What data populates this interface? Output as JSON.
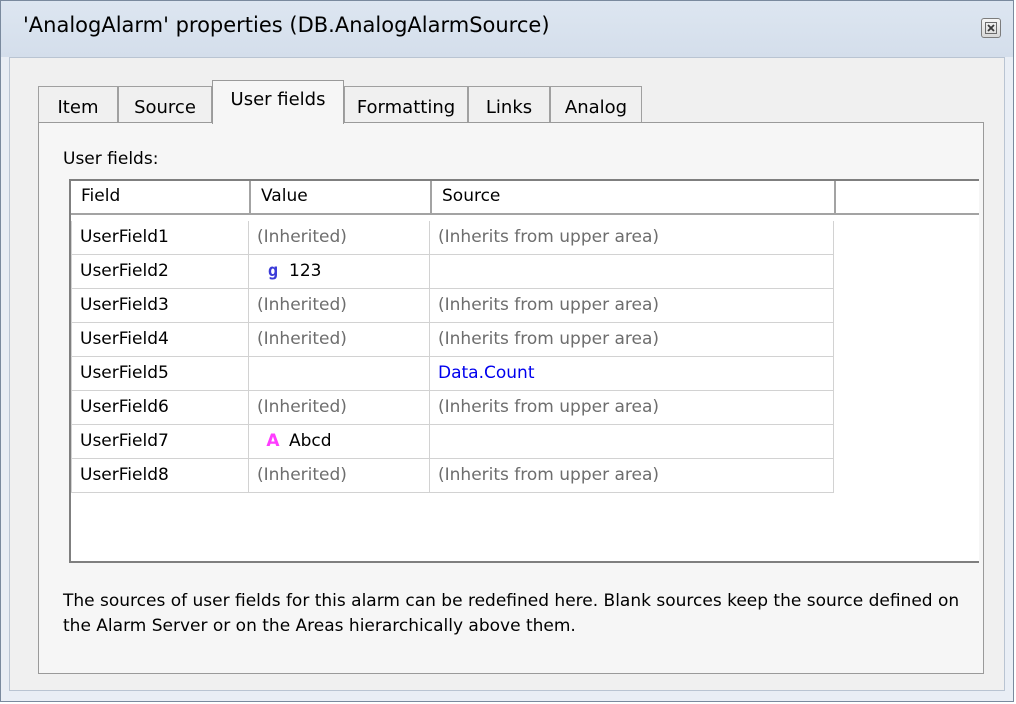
{
  "window": {
    "title": "'AnalogAlarm' properties (DB.AnalogAlarmSource)"
  },
  "tabs": [
    {
      "label": "Item",
      "active": false
    },
    {
      "label": "Source",
      "active": false
    },
    {
      "label": "User fields",
      "active": true
    },
    {
      "label": "Formatting",
      "active": false
    },
    {
      "label": "Links",
      "active": false
    },
    {
      "label": "Analog",
      "active": false
    }
  ],
  "user_fields": {
    "label": "User fields:",
    "columns": [
      "Field",
      "Value",
      "Source"
    ],
    "rows": [
      {
        "field": "UserField1",
        "value": "(Inherited)",
        "source": "(Inherits from upper area)"
      },
      {
        "field": "UserField2",
        "value_icon": "g",
        "value": "123",
        "source": ""
      },
      {
        "field": "UserField3",
        "value": "(Inherited)",
        "source": "(Inherits from upper area)"
      },
      {
        "field": "UserField4",
        "value": "(Inherited)",
        "source": "(Inherits from upper area)"
      },
      {
        "field": "UserField5",
        "value": "",
        "source": "Data.Count"
      },
      {
        "field": "UserField6",
        "value": "(Inherited)",
        "source": "(Inherits from upper area)"
      },
      {
        "field": "UserField7",
        "value_icon": "A",
        "value": "Abcd",
        "source": ""
      },
      {
        "field": "UserField8",
        "value": "(Inherited)",
        "source": "(Inherits from upper area)"
      }
    ]
  },
  "description": "The sources of user fields for this alarm can be redefined here. Blank sources keep the source defined on the Alarm Server or on the Areas hierarchically above them.",
  "icons": {
    "close": "close-icon",
    "numeric_value": "numeric-value-icon",
    "text_value": "text-value-icon"
  },
  "colors": {
    "numeric_icon": "#3b3bd8",
    "text_icon": "#ff3cff",
    "link_text": "#0000ee",
    "inherited_text": "#6d6d6d"
  }
}
